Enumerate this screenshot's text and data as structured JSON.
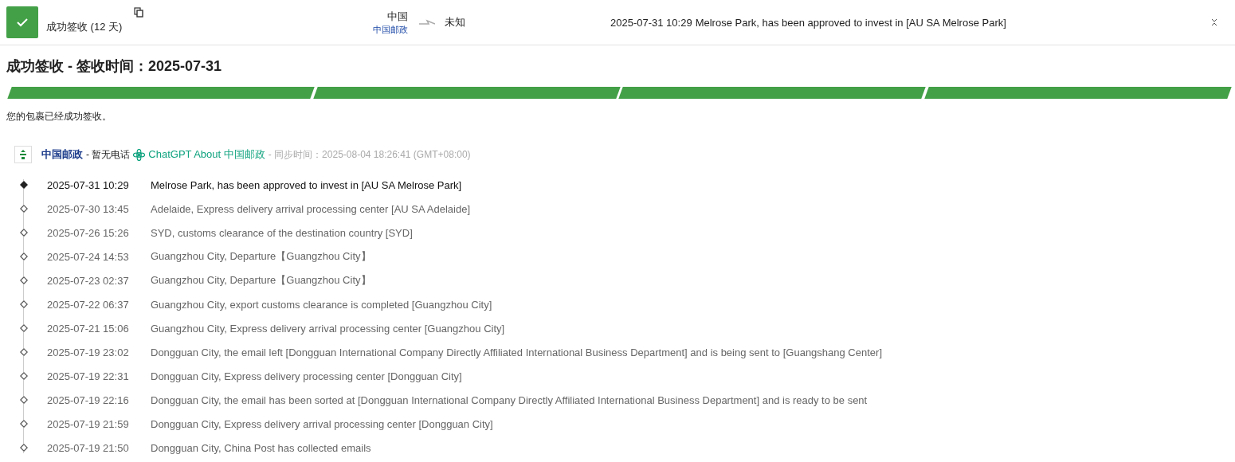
{
  "header": {
    "status": "成功签收 (12 天)",
    "origin": {
      "country": "中国",
      "carrier": "中国邮政"
    },
    "destination": "未知",
    "latest_time": "2025-07-31 10:29",
    "latest_event": "Melrose Park, has been approved to invest in [AU SA Melrose Park]"
  },
  "title": "成功签收 - 签收时间：2025-07-31",
  "progress": [
    {
      "done": true
    },
    {
      "done": true
    },
    {
      "done": true
    },
    {
      "done": true
    }
  ],
  "message": "您的包裹已经成功签收。",
  "carrier": {
    "name": "中国邮政",
    "phone": "- 暂无电话",
    "chatgpt": "ChatGPT About 中国邮政",
    "sync": "- 同步时间：2025-08-04 18:26:41 (GMT+08:00)"
  },
  "events": [
    {
      "time": "2025-07-31 10:29",
      "text": "Melrose Park, has been approved to invest in [AU SA Melrose Park]",
      "latest": true
    },
    {
      "time": "2025-07-30 13:45",
      "text": "Adelaide, Express delivery arrival processing center [AU SA Adelaide]",
      "latest": false
    },
    {
      "time": "2025-07-26 15:26",
      "text": "SYD, customs clearance of the destination country [SYD]",
      "latest": false
    },
    {
      "time": "2025-07-24 14:53",
      "text": "Guangzhou City, Departure【Guangzhou City】",
      "latest": false
    },
    {
      "time": "2025-07-23 02:37",
      "text": "Guangzhou City, Departure【Guangzhou City】",
      "latest": false
    },
    {
      "time": "2025-07-22 06:37",
      "text": "Guangzhou City, export customs clearance is completed [Guangzhou City]",
      "latest": false
    },
    {
      "time": "2025-07-21 15:06",
      "text": "Guangzhou City, Express delivery arrival processing center [Guangzhou City]",
      "latest": false
    },
    {
      "time": "2025-07-19 23:02",
      "text": "Dongguan City, the email left [Dongguan International Company Directly Affiliated International Business Department] and is being sent to [Guangshang Center]",
      "latest": false
    },
    {
      "time": "2025-07-19 22:31",
      "text": "Dongguan City, Express delivery processing center [Dongguan City]",
      "latest": false
    },
    {
      "time": "2025-07-19 22:16",
      "text": "Dongguan City, the email has been sorted at [Dongguan International Company Directly Affiliated International Business Department] and is ready to be sent",
      "latest": false
    },
    {
      "time": "2025-07-19 21:59",
      "text": "Dongguan City, Express delivery arrival processing center [Dongguan City]",
      "latest": false
    },
    {
      "time": "2025-07-19 21:50",
      "text": "Dongguan City, China Post has collected emails",
      "latest": false
    }
  ]
}
